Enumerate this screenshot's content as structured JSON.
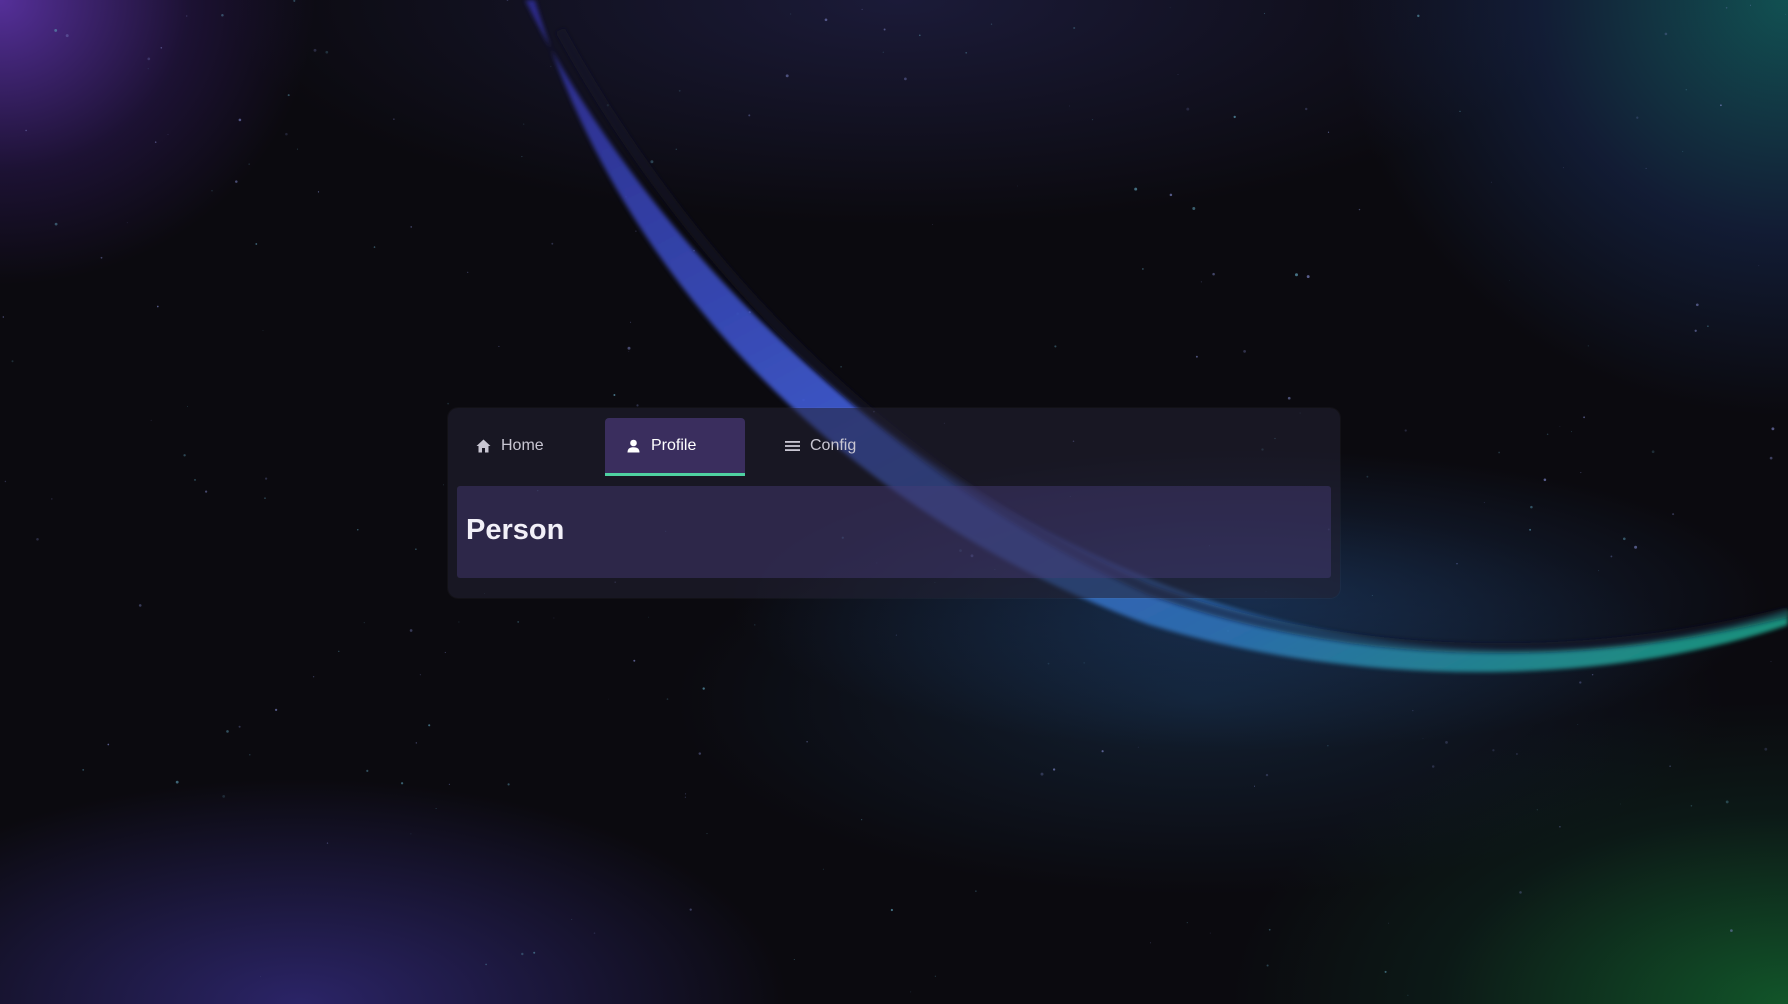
{
  "tabs": [
    {
      "label": "Home",
      "icon": "home-icon",
      "active": false
    },
    {
      "label": "Profile",
      "icon": "user-icon",
      "active": true
    },
    {
      "label": "Config",
      "icon": "menu-icon",
      "active": false
    }
  ],
  "panel": {
    "title": "Person"
  },
  "colors": {
    "accent": "#4fd1a1",
    "active_tab_bg": "#463773",
    "panel_bg": "#483c78"
  }
}
